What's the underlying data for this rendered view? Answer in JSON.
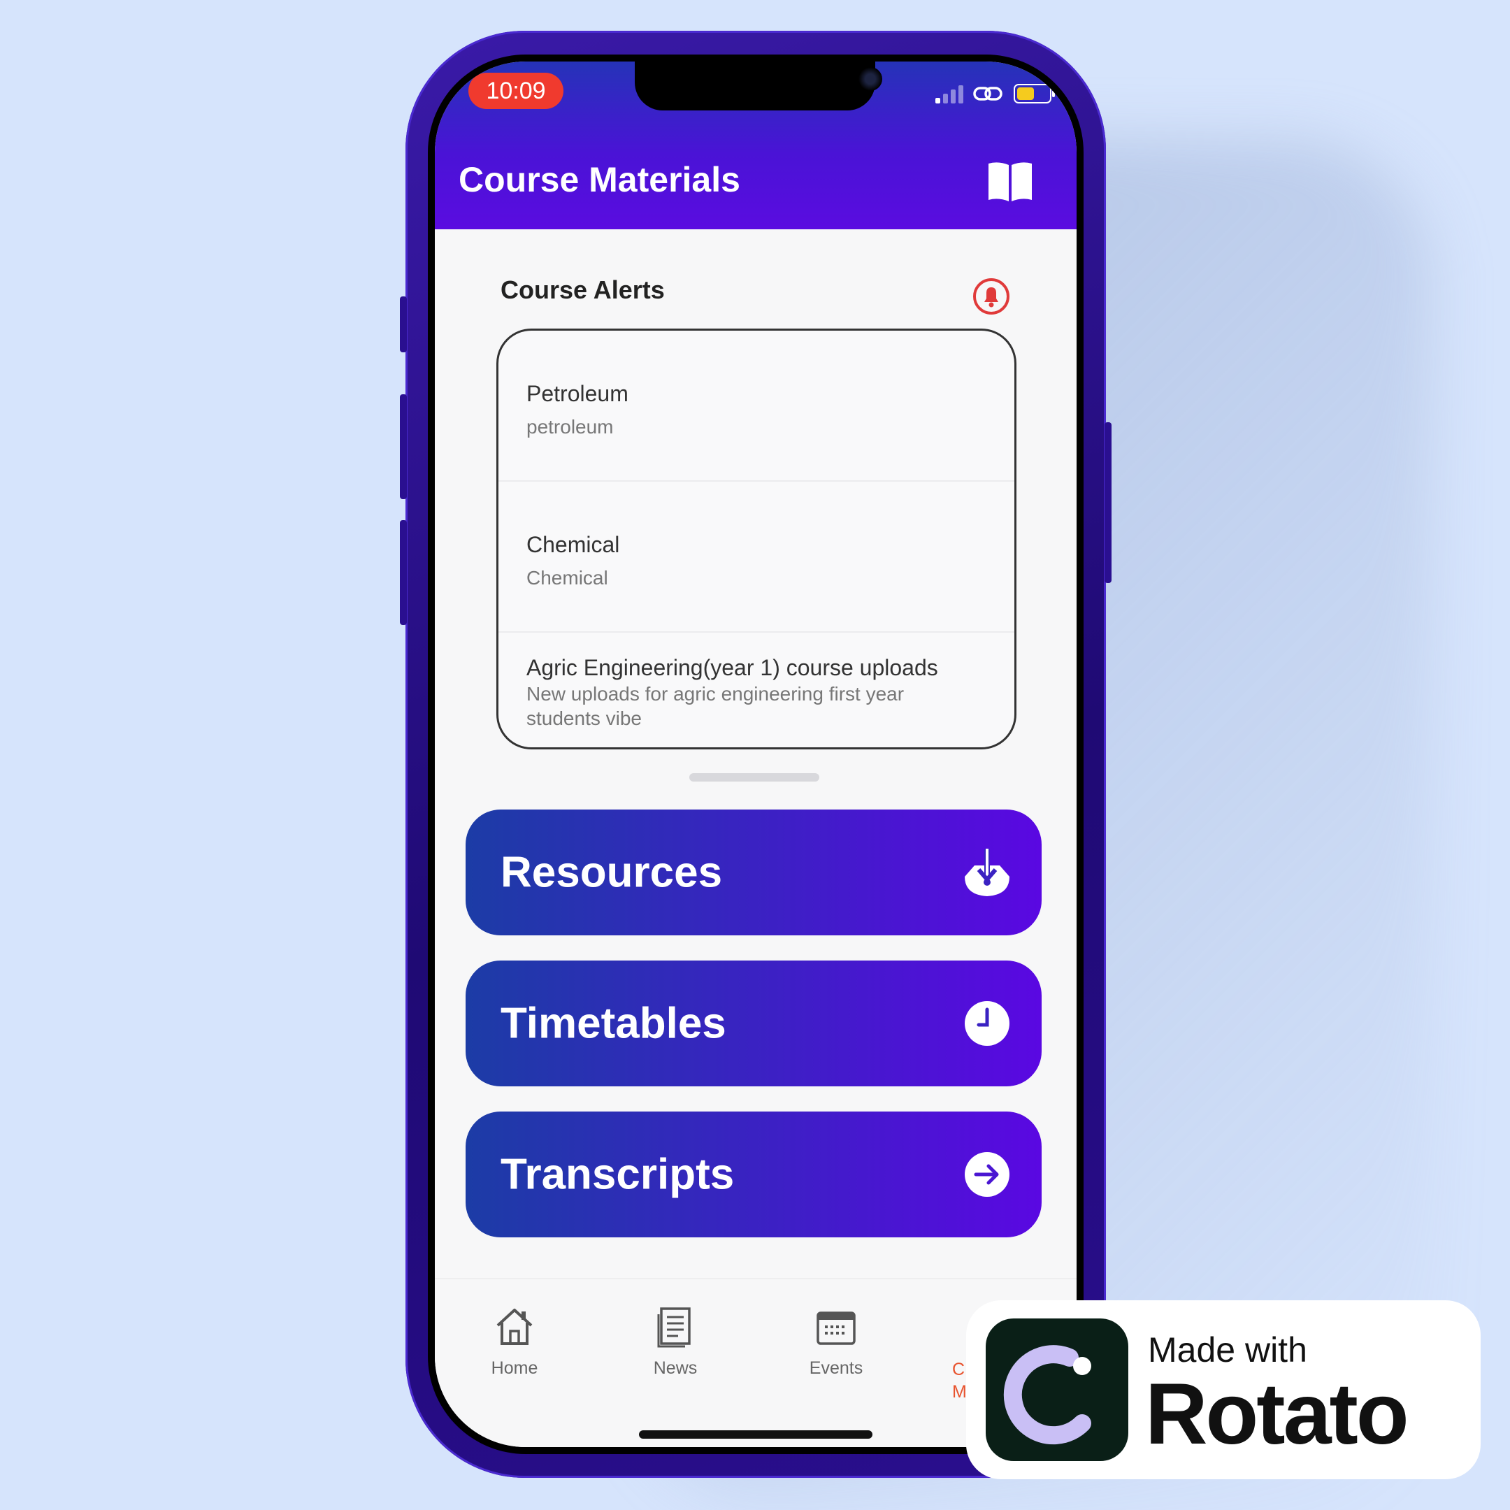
{
  "status_bar": {
    "time": "10:09"
  },
  "header": {
    "title": "Course Materials"
  },
  "alerts": {
    "title": "Course Alerts",
    "items": [
      {
        "title": "Petroleum",
        "subtitle": "petroleum"
      },
      {
        "title": "Chemical",
        "subtitle": "Chemical"
      },
      {
        "title": "Agric Engineering(year 1) course uploads",
        "subtitle": "New uploads for agric engineering first year students vibe"
      }
    ]
  },
  "actions": {
    "resources": "Resources",
    "timetables": "Timetables",
    "transcripts": "Transcripts"
  },
  "tabs": {
    "home": "Home",
    "news": "News",
    "events": "Events",
    "partial_label_top": "C",
    "partial_label_bottom": "M"
  },
  "badge": {
    "made_with": "Made with",
    "name": "Rotato"
  },
  "colors": {
    "accent": "#5a0ce0",
    "header_start": "#2533b8",
    "button_start": "#1c3ca6",
    "alert_icon": "#e03a3a",
    "active_tab": "#e8532e"
  },
  "icons": {
    "header": "book-open-icon",
    "alerts": "bell-icon",
    "resources": "download-tray-icon",
    "timetables": "clock-icon",
    "transcripts": "arrow-right-circle-icon"
  }
}
